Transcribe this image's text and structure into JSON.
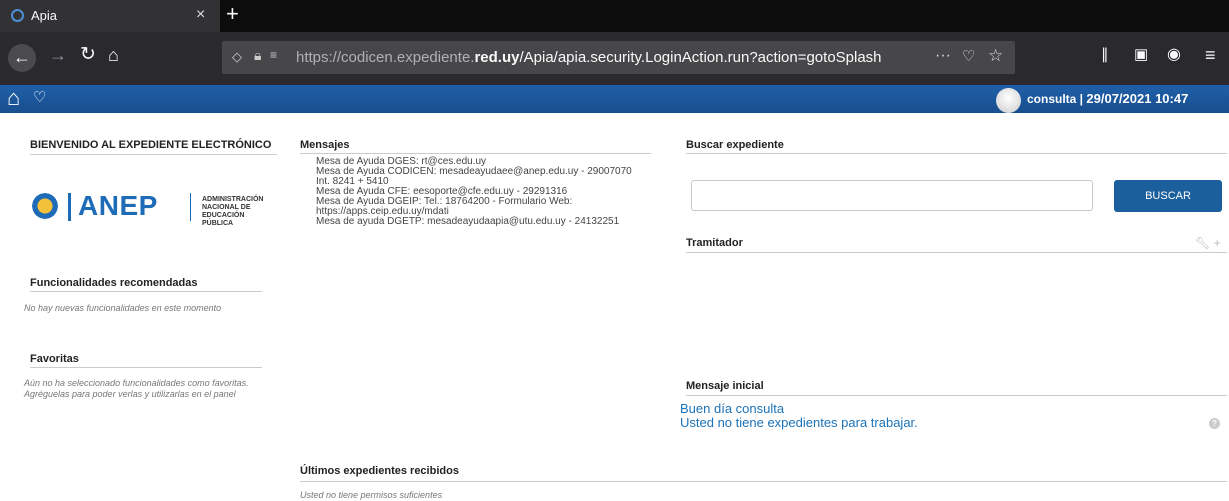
{
  "browser": {
    "tab_title": "Apia",
    "tab_close": "×",
    "new_tab": "+",
    "url_scheme_host": "https://codicen.expediente.",
    "url_domain": "red.uy",
    "url_path": "/Apia/apia.security.LoginAction.run?action=gotoSplash",
    "page_actions": "···"
  },
  "header": {
    "user": "consulta |",
    "datetime": "29/07/2021 10:47"
  },
  "left": {
    "welcome_title": "BIENVENIDO AL EXPEDIENTE ELECTRÓNICO",
    "logo_text": "ANEP",
    "logo_sub": "ADMINISTRACIÓN\nNACIONAL DE\nEDUCACIÓN PÚBLICA",
    "func_title": "Funcionalidades recomendadas",
    "func_empty": "No hay nuevas funcionalidades en este momento",
    "fav_title": "Favoritas",
    "fav_empty": "Aún no ha seleccionado funcionalidades como favoritas.\nAgréguelas para poder verlas y utilizarlas en el panel"
  },
  "mensajes": {
    "title": "Mensajes",
    "body": "Mesa de Ayuda DGES: rt@ces.edu.uy\nMesa de Ayuda CODICEN: mesadeayudaee@anep.edu.uy - 29007070\nInt. 8241 + 5410\nMesa de Ayuda CFE: eesoporte@cfe.edu.uy - 29291316\nMesa de Ayuda DGEIP: Tel.: 18764200 - Formulario Web:\nhttps://apps.ceip.edu.uy/mdati\nMesa de ayuda DGETP: mesadeayudaapia@utu.edu.uy - 24132251"
  },
  "buscar": {
    "title": "Buscar expediente",
    "button": "BUSCAR"
  },
  "tramitador": {
    "title": "Tramitador"
  },
  "mensaje_inicial": {
    "title": "Mensaje inicial",
    "line1": "Buen día consulta",
    "line2": "Usted no tiene expedientes para trabajar.",
    "help": "?"
  },
  "ultimos": {
    "title": "Últimos expedientes recibidos",
    "empty": "Usted no tiene permisos suficientes"
  }
}
